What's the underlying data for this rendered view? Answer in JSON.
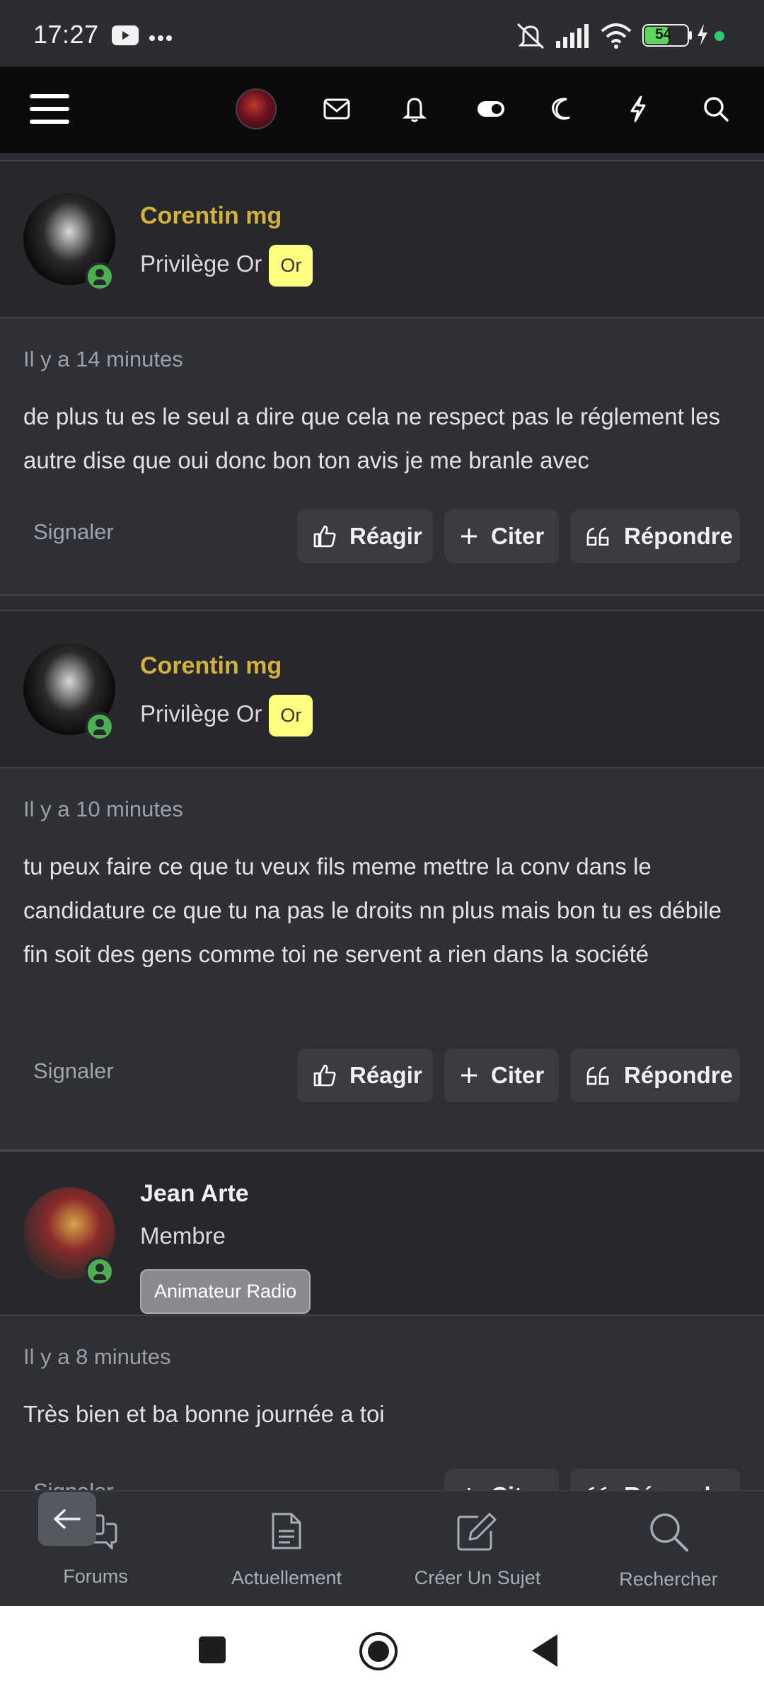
{
  "status": {
    "time": "17:27",
    "battery": "54"
  },
  "nav": {
    "icons": [
      "menu-icon",
      "avatar",
      "mail-icon",
      "bell-icon",
      "toggle-icon",
      "moon-icon",
      "bolt-icon",
      "search-icon"
    ]
  },
  "posts": [
    {
      "username": "Corentin mg",
      "rank": "Privilège Or",
      "badge": "Or",
      "time": "Il y a 14 minutes",
      "message": "de plus tu es le seul a dire que cela ne respect pas le réglement les autre dise que oui donc bon ton avis je me branle avec",
      "signaler": "Signaler",
      "react": "Réagir",
      "quote": "Citer",
      "reply": "Répondre"
    },
    {
      "username": "Corentin mg",
      "rank": "Privilège Or",
      "badge": "Or",
      "time": "Il y a 10 minutes",
      "message": "tu peux faire ce que tu veux fils meme mettre la conv dans le candidature ce que tu na pas le droits nn plus mais bon tu es débile fin soit des gens comme toi ne servent a rien dans la société",
      "signaler": "Signaler",
      "react": "Réagir",
      "quote": "Citer",
      "reply": "Répondre"
    },
    {
      "username": "Jean Arte",
      "rank": "Membre",
      "badge": "Animateur Radio",
      "time": "Il y a 8 minutes",
      "message": "Très bien et ba bonne journée a toi",
      "signaler": "Signaler",
      "quote": "Citer",
      "reply": "Répondre"
    }
  ],
  "bottom_nav": [
    {
      "label": "Forums",
      "icon": "chat-bubbles-icon"
    },
    {
      "label": "Actuellement",
      "icon": "document-icon"
    },
    {
      "label": "Créer Un Sujet",
      "icon": "edit-icon"
    },
    {
      "label": "Rechercher",
      "icon": "search-icon"
    }
  ]
}
